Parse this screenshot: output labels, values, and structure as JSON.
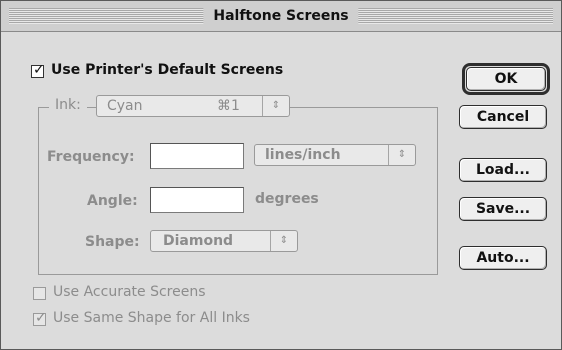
{
  "window": {
    "title": "Halftone Screens"
  },
  "use_printer_default": {
    "label": "Use Printer's Default Screens",
    "checked": true
  },
  "ink": {
    "label": "Ink:",
    "selected": "Cyan",
    "shortcut": "⌘1"
  },
  "frequency": {
    "label": "Frequency:",
    "value": "",
    "unit_selected": "lines/inch"
  },
  "angle": {
    "label": "Angle:",
    "value": "",
    "unit": "degrees"
  },
  "shape": {
    "label": "Shape:",
    "selected": "Diamond"
  },
  "use_accurate": {
    "label": "Use Accurate Screens",
    "checked": false
  },
  "use_same_shape": {
    "label": "Use Same Shape for All Inks",
    "checked": true
  },
  "buttons": {
    "ok": "OK",
    "cancel": "Cancel",
    "load": "Load...",
    "save": "Save...",
    "auto": "Auto..."
  },
  "icons": {
    "popup_arrow": "up-down-arrows-icon",
    "check": "checkmark-icon"
  }
}
